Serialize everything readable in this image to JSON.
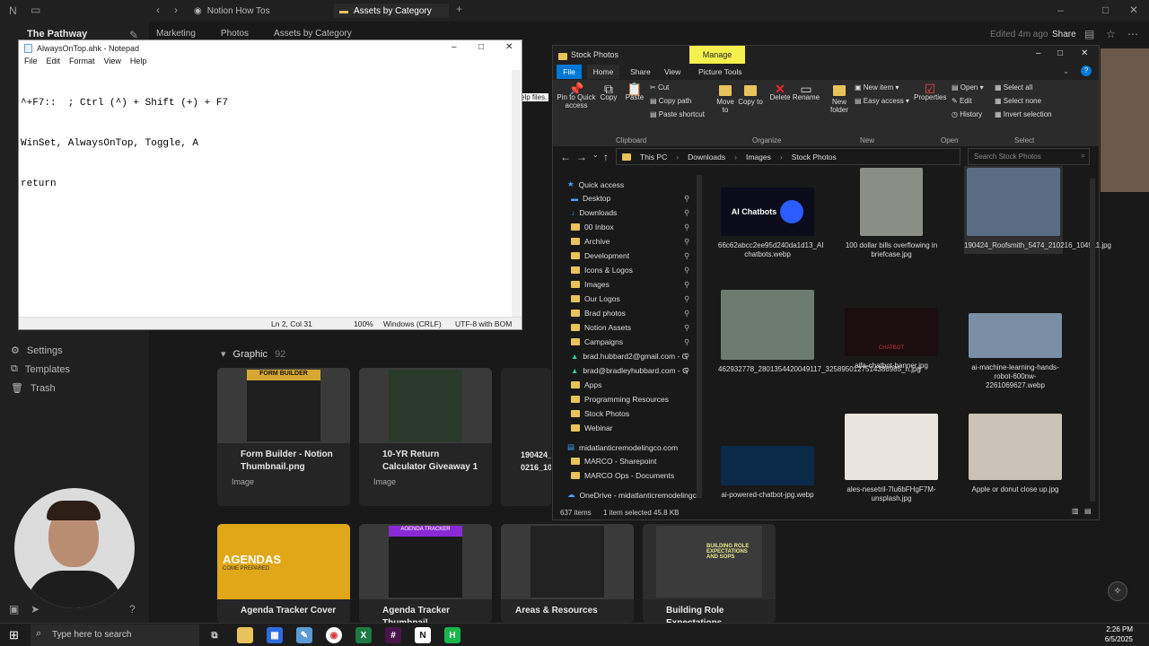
{
  "notion": {
    "workspace": "The Pathway",
    "tabs": [
      {
        "label": "Notion How Tos"
      },
      {
        "label": "Assets by Category"
      }
    ],
    "breadcrumb": [
      "Marketing",
      "Photos",
      "Assets by Category"
    ],
    "edited": "Edited 4m ago",
    "share": "Share",
    "sidebar_items": [
      "Settings",
      "Templates",
      "Trash"
    ],
    "group": {
      "name": "Graphic",
      "count": "92"
    },
    "cards_row1": [
      {
        "title": "Form Builder - Notion Thumbnail.png",
        "tag": "Image",
        "thumb_text": "FORM BUILDER"
      },
      {
        "title": "10-YR Return Calculator Giveaway 1",
        "tag": "Image",
        "thumb_text": ""
      },
      {
        "title": "190424_ 0216_10",
        "tag": "",
        "thumb_text": ""
      }
    ],
    "cards_row2": [
      {
        "title": "Agenda Tracker Cover",
        "thumb_text": "AGENDAS",
        "sub": "COME PREPARED"
      },
      {
        "title": "Agenda Tracker Thumbnail",
        "thumb_text": "AGENDA TRACKER"
      },
      {
        "title": "Areas & Resources",
        "thumb_text": ""
      },
      {
        "title": "Building Role Expectations",
        "thumb_text": "BUILDING ROLE EXPECTATIONS AND SOPS"
      }
    ],
    "help_text": "elp files."
  },
  "notepad": {
    "title": "AlwaysOnTop.ahk - Notepad",
    "menu": [
      "File",
      "Edit",
      "Format",
      "View",
      "Help"
    ],
    "lines": [
      "^+F7::  ; Ctrl (^) + Shift (+) + F7",
      "WinSet, AlwaysOnTop, Toggle, A",
      "return"
    ],
    "status": {
      "position": "Ln 2, Col 31",
      "zoom": "100%",
      "eol": "Windows (CRLF)",
      "encoding": "UTF-8 with BOM"
    }
  },
  "explorer": {
    "title": "Stock Photos",
    "manage": "Manage",
    "ribbon_tabs": [
      "File",
      "Home",
      "Share",
      "View",
      "Picture Tools"
    ],
    "clipboard": {
      "pin": "Pin to Quick access",
      "copy": "Copy",
      "paste": "Paste",
      "cut": "Cut",
      "copy_path": "Copy path",
      "paste_shortcut": "Paste shortcut",
      "group": "Clipboard"
    },
    "organize": {
      "move": "Move to",
      "copy": "Copy to",
      "delete": "Delete",
      "rename": "Rename",
      "group": "Organize"
    },
    "new": {
      "folder": "New folder",
      "item": "New item",
      "easy": "Easy access",
      "group": "New"
    },
    "open": {
      "properties": "Properties",
      "open": "Open",
      "edit": "Edit",
      "history": "History",
      "group": "Open"
    },
    "select": {
      "all": "Select all",
      "none": "Select none",
      "invert": "Invert selection",
      "group": "Select"
    },
    "path": [
      "This PC",
      "Downloads",
      "Images",
      "Stock Photos"
    ],
    "search_placeholder": "Search Stock Photos",
    "nav": [
      "Quick access",
      "Desktop",
      "Downloads",
      "00 Inbox",
      "Archive",
      "Development",
      "Icons & Logos",
      "Images",
      "Our Logos",
      "Brad photos",
      "Notion Assets",
      "Campaigns",
      "brad.hubbard2@gmail.com - G",
      "brad@bradleyhubbard.com - G",
      "Apps",
      "Programming Resources",
      "Stock Photos",
      "Webinar",
      "midatlanticremodelingco.com",
      "MARCO - Sharepoint",
      "MARCO Ops - Documents",
      "OneDrive - midatlanticremodelingc"
    ],
    "files": [
      {
        "name": "66c62abcc2ee95d240da1d13_AI chatbots.webp",
        "label": "AI Chatbots"
      },
      {
        "name": "100 dollar bills overflowing in briefcase.jpg",
        "label": ""
      },
      {
        "name": "190424_Roofsmith_5474_210216_104911.jpg",
        "label": ""
      },
      {
        "name": "462932778_2801354420049117_3258950127514386985_n.jpg",
        "label": ""
      },
      {
        "name": "aifa-chatbot-banner.jpg",
        "label": "CHATBOT"
      },
      {
        "name": "ai-machine-learning-hands-robot-600nw-2261069627.webp",
        "label": ""
      },
      {
        "name": "ai-powered-chatbot-jpg.webp",
        "label": ""
      },
      {
        "name": "ales-nesetril-7lu6bFHgF7M-unsplash.jpg",
        "label": ""
      },
      {
        "name": "Apple or donut close up.jpg",
        "label": ""
      }
    ],
    "status": {
      "count": "637 items",
      "selected": "1 item selected  45.8 KB"
    }
  },
  "taskbar": {
    "search_placeholder": "Type here to search",
    "time": "2:26 PM",
    "date": "6/5/2025"
  },
  "colors": {
    "folder": "#e8c25a",
    "accent": "#0078d7",
    "manage": "#f5f04d"
  }
}
